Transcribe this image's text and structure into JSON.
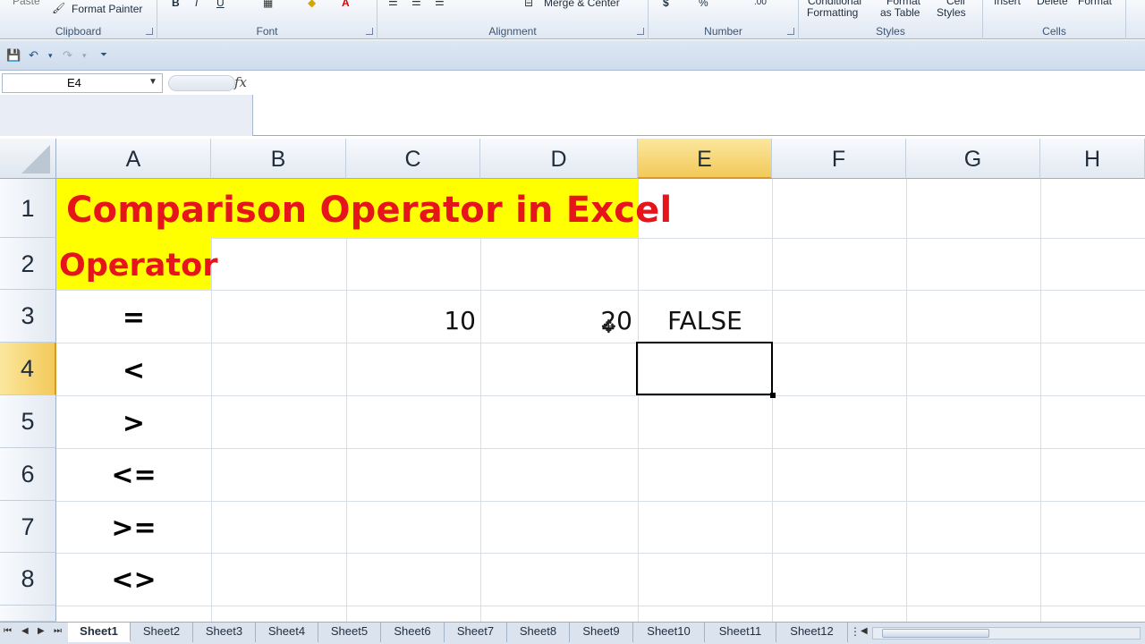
{
  "ribbon": {
    "clipboard": {
      "label": "Clipboard",
      "paste": "Paste",
      "format_painter": "Format Painter"
    },
    "font": {
      "label": "Font"
    },
    "alignment": {
      "label": "Alignment",
      "merge_center": "Merge & Center"
    },
    "number": {
      "label": "Number"
    },
    "styles": {
      "label": "Styles",
      "conditional": "Conditional",
      "formatting": "Formatting",
      "format": "Format",
      "as_table": "as Table",
      "cell": "Cell",
      "styles_btn": "Styles"
    },
    "cells": {
      "label": "Cells",
      "insert": "Insert",
      "delete": "Delete",
      "format": "Format"
    }
  },
  "formula_bar": {
    "name_box": "E4",
    "fx": "fx",
    "formula": ""
  },
  "columns": [
    "A",
    "B",
    "C",
    "D",
    "E",
    "F",
    "G",
    "H"
  ],
  "rows": [
    "1",
    "2",
    "3",
    "4",
    "5",
    "6",
    "7",
    "8"
  ],
  "cells": {
    "A1": "Comparison Operator in Excel",
    "A2": "Operator",
    "A3": "=",
    "A4": "<",
    "A5": ">",
    "A6": "<=",
    "A7": ">=",
    "A8": "<>",
    "C3": "10",
    "D3": "20",
    "E3": "FALSE"
  },
  "colors": {
    "highlight": "#ffff00",
    "title_red": "#e5151b",
    "active_header": "#f3c95a"
  },
  "sheets": [
    "Sheet1",
    "Sheet2",
    "Sheet3",
    "Sheet4",
    "Sheet5",
    "Sheet6",
    "Sheet7",
    "Sheet8",
    "Sheet9",
    "Sheet10",
    "Sheet11",
    "Sheet12"
  ],
  "active_sheet": "Sheet1"
}
